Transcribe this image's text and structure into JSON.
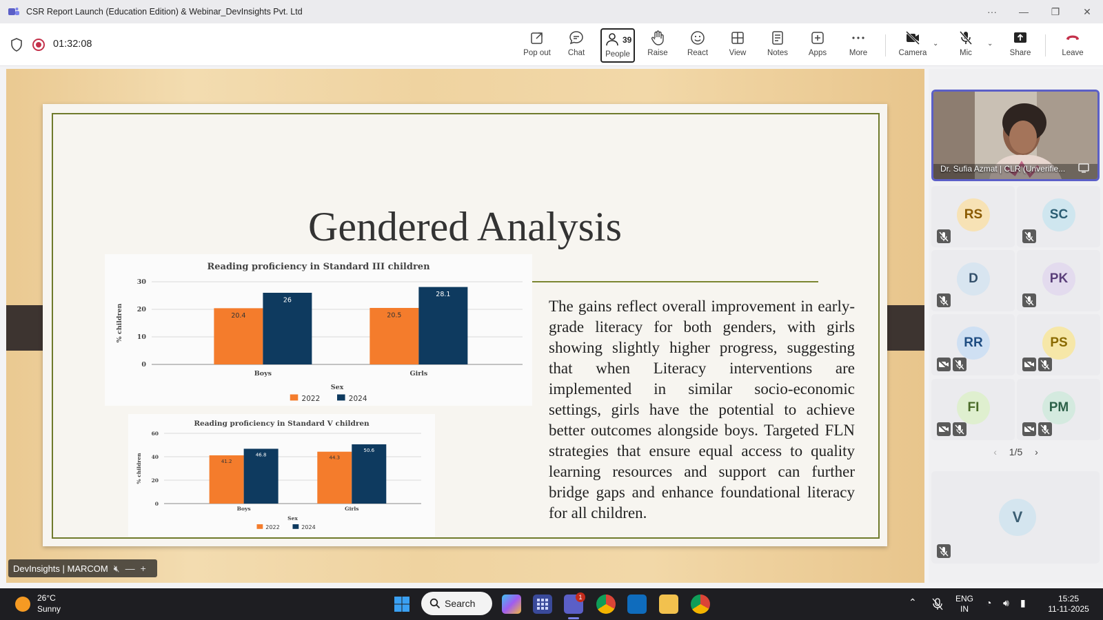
{
  "window": {
    "title": "CSR Report Launch (Education Edition) & Webinar_DevInsights Pvt. Ltd",
    "more": "···",
    "minimize": "—",
    "restore": "❐",
    "close": "✕"
  },
  "meeting": {
    "timer": "01:32:08",
    "toolbar": {
      "popout": "Pop out",
      "chat": "Chat",
      "people": "People",
      "people_count": "39",
      "raise": "Raise",
      "react": "React",
      "view": "View",
      "notes": "Notes",
      "apps": "Apps",
      "more": "More",
      "camera": "Camera",
      "mic": "Mic",
      "share": "Share",
      "leave": "Leave"
    }
  },
  "slide": {
    "title": "Gendered Analysis",
    "body": "The gains reflect overall improvement in early-grade literacy for both genders, with girls showing slightly higher progress, suggesting that when Literacy interventions are implemented in similar socio-economic settings, girls have the potential to achieve better outcomes alongside boys. Targeted FLN strategies that ensure equal access to quality learning resources and support can further bridge gaps and enhance foundational literacy for all children."
  },
  "chart_data": [
    {
      "type": "bar",
      "title": "Reading proficiency in Standard III children",
      "xlabel": "Sex",
      "ylabel": "% children",
      "categories": [
        "Boys",
        "Girls"
      ],
      "series": [
        {
          "name": "2022",
          "values": [
            20.4,
            20.5
          ],
          "color": "#f47c2c"
        },
        {
          "name": "2024",
          "values": [
            26,
            28.1
          ],
          "color": "#0e3a5f"
        }
      ],
      "ylim": [
        0,
        30
      ],
      "yticks": [
        0,
        10,
        20,
        30
      ],
      "grid": true,
      "legend": "bottom"
    },
    {
      "type": "bar",
      "title": "Reading proficiency in Standard V children",
      "xlabel": "Sex",
      "ylabel": "% children",
      "categories": [
        "Boys",
        "Girls"
      ],
      "series": [
        {
          "name": "2022",
          "values": [
            41.2,
            44.3
          ],
          "color": "#f47c2c"
        },
        {
          "name": "2024",
          "values": [
            46.8,
            50.6
          ],
          "color": "#0e3a5f"
        }
      ],
      "ylim": [
        0,
        60
      ],
      "yticks": [
        0,
        20,
        40,
        60
      ],
      "grid": true,
      "legend": "bottom"
    }
  ],
  "participants": {
    "speaker": "Dr. Sufia Azmat | CLR (Unverifie...",
    "tiles": [
      {
        "initials": "RS",
        "bg": "#f7e2b5",
        "fg": "#8a5a00"
      },
      {
        "initials": "SC",
        "bg": "#cfe6ef",
        "fg": "#2b5d73"
      },
      {
        "initials": "D",
        "bg": "#d8e5f0",
        "fg": "#33506b"
      },
      {
        "initials": "PK",
        "bg": "#e3dbee",
        "fg": "#5a3f7a"
      },
      {
        "initials": "RR",
        "bg": "#cfe0f3",
        "fg": "#1f4d82"
      },
      {
        "initials": "PS",
        "bg": "#f6e7a8",
        "fg": "#8a6a00"
      },
      {
        "initials": "FI",
        "bg": "#dfefcf",
        "fg": "#4a6b28"
      },
      {
        "initials": "PM",
        "bg": "#d4eadf",
        "fg": "#2d6149"
      }
    ],
    "pager": "1/5",
    "extra": {
      "initials": "V",
      "bg": "#d4e5ef",
      "fg": "#3b5e73"
    },
    "presenter_badge": "DevInsights | MARCOM"
  },
  "taskbar": {
    "temp": "26°C",
    "weather": "Sunny",
    "search": "Search",
    "teams_badge": "1",
    "lang_top": "ENG",
    "lang_bottom": "IN",
    "time": "15:25",
    "date": "11-11-2025"
  }
}
